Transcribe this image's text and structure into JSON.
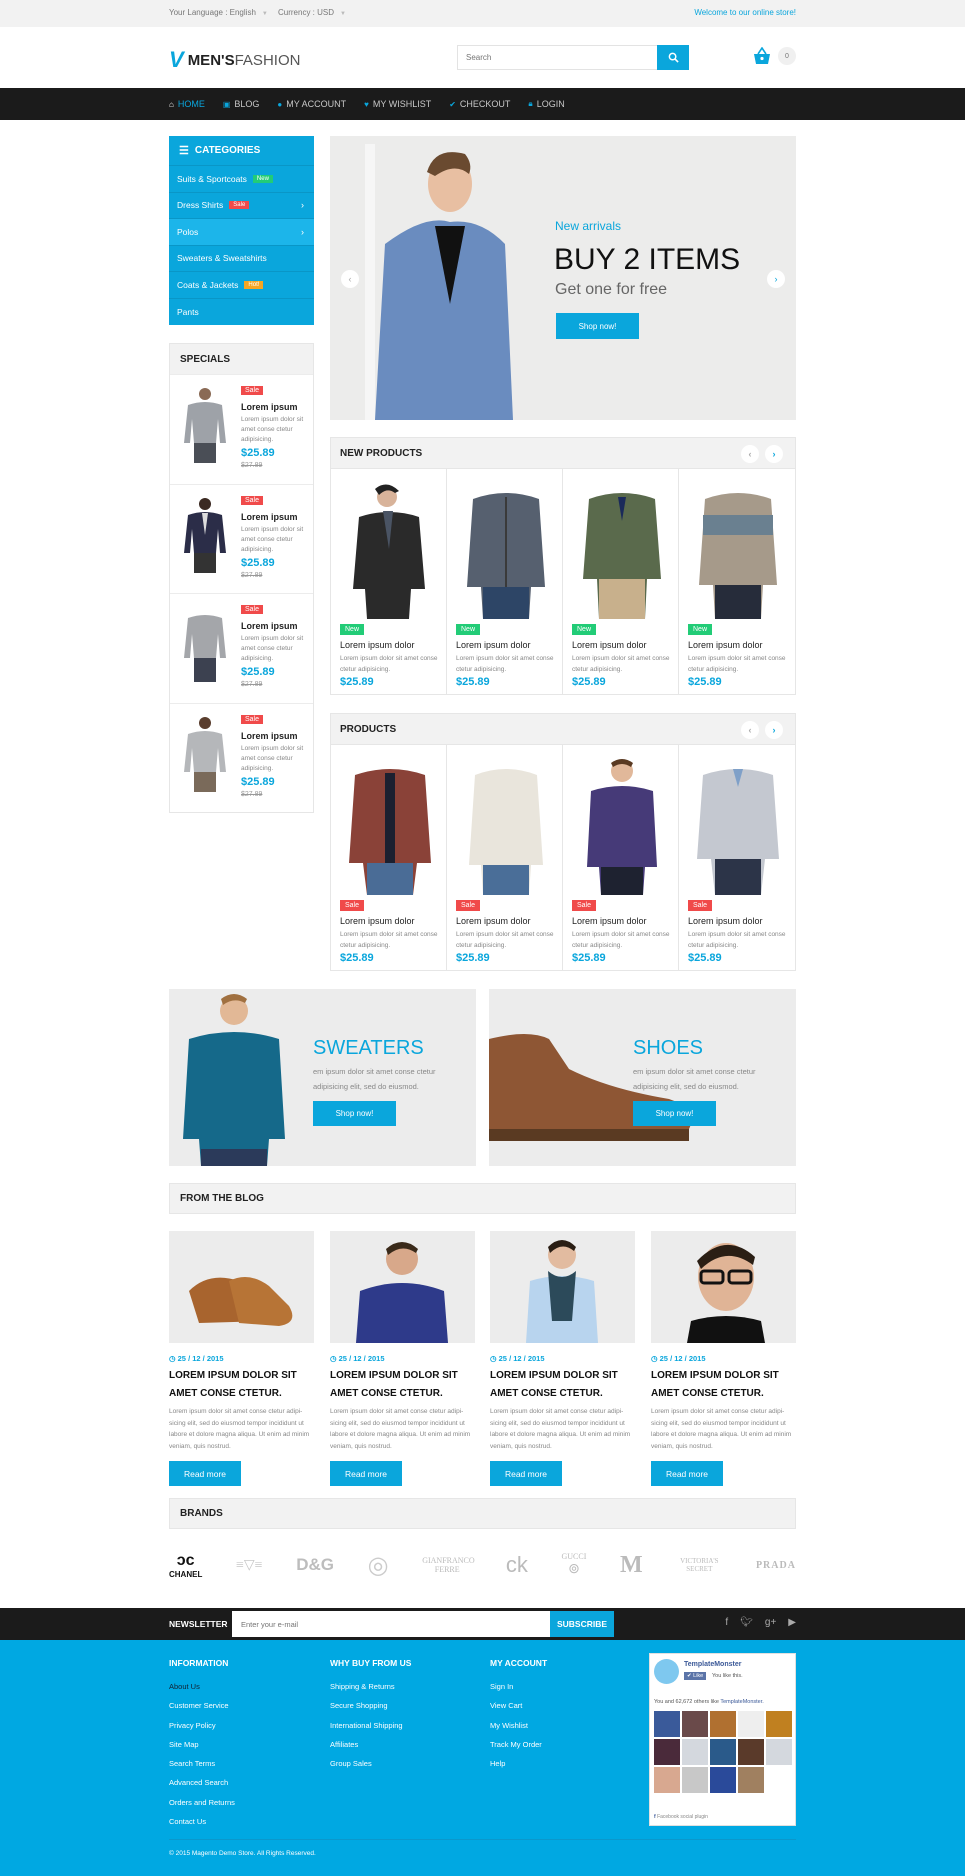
{
  "topbar": {
    "language_label": "Your Language : English",
    "currency_label": "Currency : USD",
    "welcome": "Welcome to our online store!"
  },
  "header": {
    "logo_bold": "MEN'S",
    "logo_light": "FASHION",
    "search_placeholder": "Search",
    "cart_count": "0"
  },
  "nav": {
    "items": [
      {
        "label": "HOME",
        "icon": "home-icon",
        "active": true
      },
      {
        "label": "BLOG",
        "icon": "book-icon"
      },
      {
        "label": "MY ACCOUNT",
        "icon": "user-icon"
      },
      {
        "label": "MY WISHLIST",
        "icon": "heart-icon"
      },
      {
        "label": "CHECKOUT",
        "icon": "check-circle-icon"
      },
      {
        "label": "LOGIN",
        "icon": "lock-icon"
      }
    ]
  },
  "categories": {
    "title": "CATEGORIES",
    "items": [
      {
        "label": "Suits & Sportcoats",
        "badge": "New"
      },
      {
        "label": "Dress Shirts",
        "badge": "Sale",
        "has_children": true
      },
      {
        "label": "Polos",
        "has_children": true,
        "highlighted": true
      },
      {
        "label": "Sweaters & Sweatshirts"
      },
      {
        "label": "Coats & Jackets",
        "badge": "Hot!"
      },
      {
        "label": "Pants"
      }
    ]
  },
  "specials": {
    "title": "SPECIALS",
    "items": [
      {
        "tag": "Sale",
        "name": "Lorem ipsum",
        "desc": "Lorem ipsum dolor sit amet conse ctetur adipisicing.",
        "price": "$25.89",
        "old_price": "$27.89"
      },
      {
        "tag": "Sale",
        "name": "Lorem ipsum",
        "desc": "Lorem ipsum dolor sit amet conse ctetur adipisicing.",
        "price": "$25.89",
        "old_price": "$27.89"
      },
      {
        "tag": "Sale",
        "name": "Lorem ipsum",
        "desc": "Lorem ipsum dolor sit amet conse ctetur adipisicing.",
        "price": "$25.89",
        "old_price": "$27.89"
      },
      {
        "tag": "Sale",
        "name": "Lorem ipsum",
        "desc": "Lorem ipsum dolor sit amet conse ctetur adipisicing.",
        "price": "$25.89",
        "old_price": "$27.89"
      }
    ]
  },
  "slider": {
    "subtitle": "New arrivals",
    "title": "BUY 2 ITEMS",
    "tagline": "Get one for free",
    "button": "Shop now!"
  },
  "new_products": {
    "title": "NEW PRODUCTS",
    "items": [
      {
        "tag": "New",
        "name": "Lorem ipsum dolor",
        "desc": "Lorem ipsum dolor sit amet conse ctetur adipisicing.",
        "price": "$25.89"
      },
      {
        "tag": "New",
        "name": "Lorem ipsum dolor",
        "desc": "Lorem ipsum dolor sit amet conse ctetur adipisicing.",
        "price": "$25.89"
      },
      {
        "tag": "New",
        "name": "Lorem ipsum dolor",
        "desc": "Lorem ipsum dolor sit amet conse ctetur adipisicing.",
        "price": "$25.89"
      },
      {
        "tag": "New",
        "name": "Lorem ipsum dolor",
        "desc": "Lorem ipsum dolor sit amet conse ctetur adipisicing.",
        "price": "$25.89"
      }
    ]
  },
  "products": {
    "title": "PRODUCTS",
    "items": [
      {
        "tag": "Sale",
        "name": "Lorem ipsum dolor",
        "desc": "Lorem ipsum dolor sit amet conse ctetur adipisicing.",
        "price": "$25.89"
      },
      {
        "tag": "Sale",
        "name": "Lorem ipsum dolor",
        "desc": "Lorem ipsum dolor sit amet conse ctetur adipisicing.",
        "price": "$25.89"
      },
      {
        "tag": "Sale",
        "name": "Lorem ipsum dolor",
        "desc": "Lorem ipsum dolor sit amet conse ctetur adipisicing.",
        "price": "$25.89"
      },
      {
        "tag": "Sale",
        "name": "Lorem ipsum dolor",
        "desc": "Lorem ipsum dolor sit amet conse ctetur adipisicing.",
        "price": "$25.89"
      }
    ]
  },
  "banners": [
    {
      "title": "SWEATERS",
      "desc": "em ipsum dolor sit amet conse ctetur adipisicing elit, sed do eiusmod.",
      "button": "Shop now!"
    },
    {
      "title": "SHOES",
      "desc": "em ipsum dolor sit amet conse ctetur adipisicing elit, sed do eiusmod.",
      "button": "Shop now!"
    }
  ],
  "blog": {
    "title": "FROM THE BLOG",
    "posts": [
      {
        "date": "25 / 12 / 2015",
        "title": "LOREM IPSUM DOLOR SIT AMET CONSE CTETUR.",
        "desc": "Lorem ipsum dolor sit amet conse ctetur adipi-sicing elit, sed do eiusmod tempor incididunt ut labore et dolore magna aliqua. Ut enim ad minim veniam, quis nostrud.",
        "button": "Read more"
      },
      {
        "date": "25 / 12 / 2015",
        "title": "LOREM IPSUM DOLOR SIT AMET CONSE CTETUR.",
        "desc": "Lorem ipsum dolor sit amet conse ctetur adipi-sicing elit, sed do eiusmod tempor incididunt ut labore et dolore magna aliqua. Ut enim ad minim veniam, quis nostrud.",
        "button": "Read more"
      },
      {
        "date": "25 / 12 / 2015",
        "title": "LOREM IPSUM DOLOR SIT AMET CONSE CTETUR.",
        "desc": "Lorem ipsum dolor sit amet conse ctetur adipi-sicing elit, sed do eiusmod tempor incididunt ut labore et dolore magna aliqua. Ut enim ad minim veniam, quis nostrud.",
        "button": "Read more"
      },
      {
        "date": "25 / 12 / 2015",
        "title": "LOREM IPSUM DOLOR SIT AMET CONSE CTETUR.",
        "desc": "Lorem ipsum dolor sit amet conse ctetur adipi-sicing elit, sed do eiusmod tempor incididunt ut labore et dolore magna aliqua. Ut enim ad minim veniam, quis nostrud.",
        "button": "Read more"
      }
    ]
  },
  "brands": {
    "title": "BRANDS",
    "items": [
      "CHANEL",
      "ARMANI",
      "D&G",
      "VERSACE",
      "GIANFRANCO FERRE",
      "Calvin Klein",
      "GUCCI",
      "MISSONI",
      "VICTORIA'S SECRET",
      "PRADA"
    ]
  },
  "newsletter": {
    "label": "NEWSLETTER",
    "placeholder": "Enter your e-mail",
    "button": "SUBSCRIBE",
    "social": [
      "f",
      "t",
      "g+",
      "yt"
    ]
  },
  "footer": {
    "columns": [
      {
        "title": "INFORMATION",
        "links": [
          "About Us",
          "Customer Service",
          "Privacy Policy",
          "Site Map",
          "Search Terms",
          "Advanced Search",
          "Orders and Returns",
          "Contact Us"
        ]
      },
      {
        "title": "WHY BUY FROM US",
        "links": [
          "Shipping & Returns",
          "Secure Shopping",
          "International Shipping",
          "Affiliates",
          "Group Sales"
        ]
      },
      {
        "title": "MY ACCOUNT",
        "links": [
          "Sign In",
          "View Cart",
          "My Wishlist",
          "Track My Order",
          "Help"
        ]
      }
    ],
    "facebook": {
      "page_name": "TemplateMonster",
      "like_label": "Like",
      "you_like": "You like this.",
      "count_text": "You and 62,672 others like",
      "count_link": "TemplateMonster.",
      "plugin": "Facebook social plugin"
    },
    "copyright": "© 2015 Magento Demo Store. All Rights Reserved."
  },
  "colors": {
    "accent": "#0aa6dc",
    "new_badge": "#22cc77",
    "sale_badge": "#f04a4a",
    "hot_badge": "#f5a623",
    "dark_bar": "#1b1b1b"
  }
}
